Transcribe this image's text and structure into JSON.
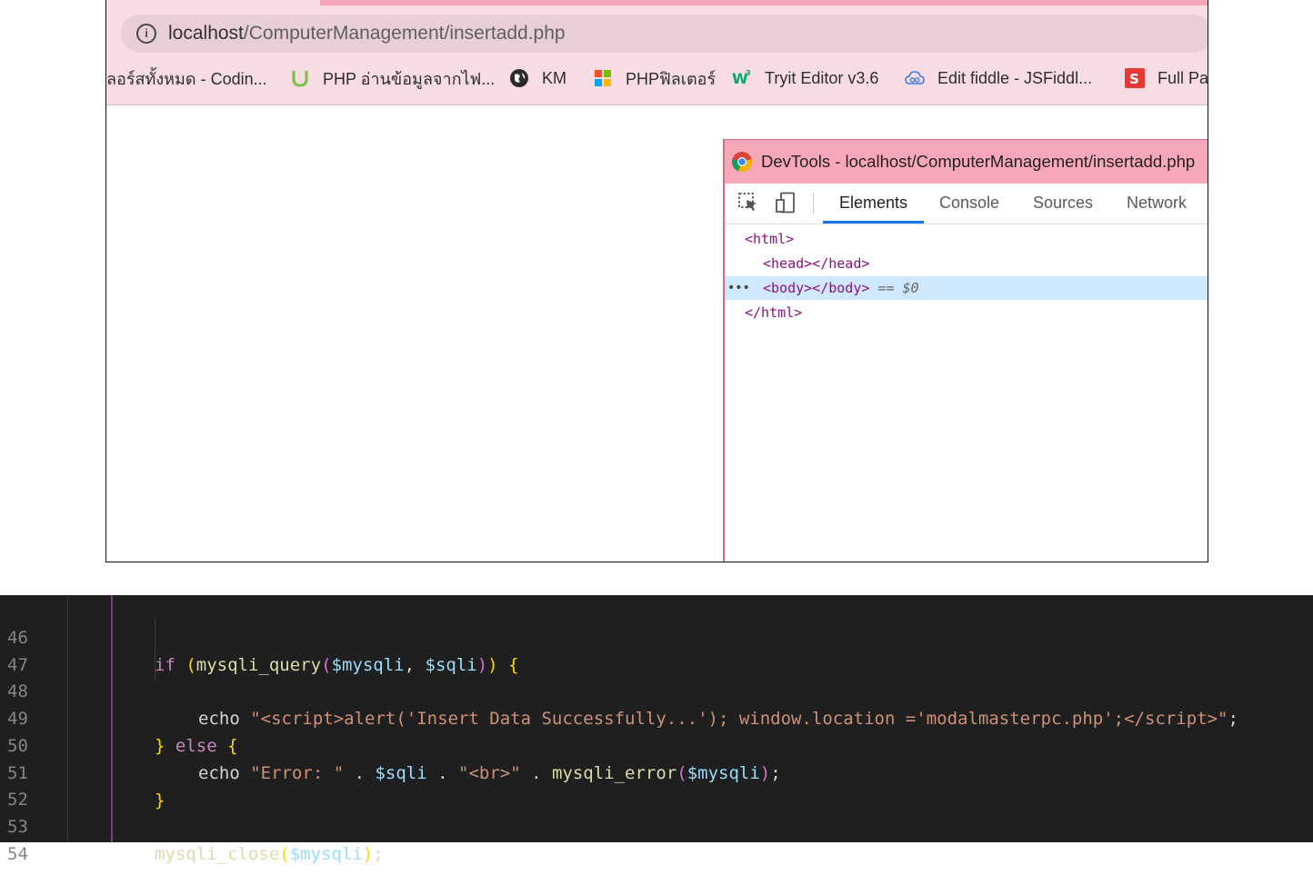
{
  "browser": {
    "url_host": "localhost",
    "url_path": "/ComputerManagement/insertadd.php",
    "bookmarks": [
      {
        "label": "ลอร์สทั้งหมด - Codin...",
        "icon": "none"
      },
      {
        "label": "PHP อ่านข้อมูลจากไฟ...",
        "icon": "green-u-icon"
      },
      {
        "label": "KM",
        "icon": "globe-icon"
      },
      {
        "label": "PHPฟิลเตอร์",
        "icon": "colored-squares-icon"
      },
      {
        "label": "Tryit Editor v3.6",
        "icon": "w3schools-icon"
      },
      {
        "label": "Edit fiddle - JSFiddl...",
        "icon": "jsfiddle-cloud-icon"
      },
      {
        "label": "Full Pa",
        "icon": "red-s-icon"
      }
    ]
  },
  "devtools": {
    "title": "DevTools - localhost/ComputerManagement/insertadd.php",
    "tabs": [
      "Elements",
      "Console",
      "Sources",
      "Network"
    ],
    "active_tab": "Elements",
    "dom": {
      "html_open": "<html>",
      "head": "<head></head>",
      "body": "<body></body>",
      "body_marker": "== $0",
      "html_close": "</html>",
      "ellipsis": "•••"
    }
  },
  "editor": {
    "line_numbers": [
      "46",
      "47",
      "48",
      "49",
      "50",
      "51",
      "52",
      "53",
      "54"
    ]
  },
  "colors": {
    "toolbar": "#f7dde3",
    "devtools_title": "#f6a8b8",
    "active_tab": "#1a73e8",
    "selected_row": "#cfe8fc",
    "editor_bg": "#1f1f1f"
  }
}
